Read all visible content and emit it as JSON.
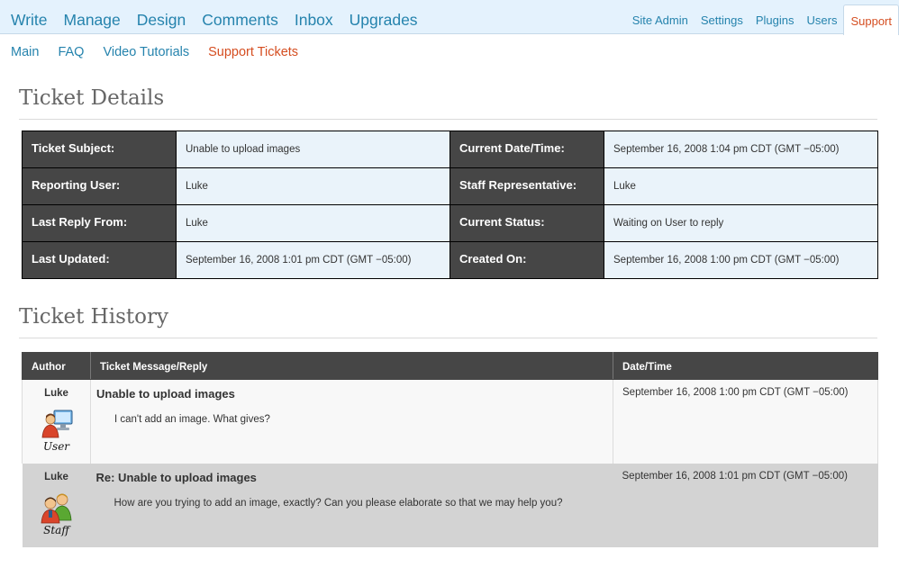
{
  "main_nav": [
    "Write",
    "Manage",
    "Design",
    "Comments",
    "Inbox",
    "Upgrades"
  ],
  "admin_nav": [
    "Site Admin",
    "Settings",
    "Plugins",
    "Users",
    "Support"
  ],
  "sub_nav": [
    "Main",
    "FAQ",
    "Video Tutorials",
    "Support Tickets"
  ],
  "details": {
    "title": "Ticket Details",
    "rows": [
      {
        "label1": "Ticket Subject:",
        "value1": "Unable to upload images",
        "label2": "Current Date/Time:",
        "value2": "September 16, 2008 1:04 pm CDT (GMT −05:00)"
      },
      {
        "label1": "Reporting User:",
        "value1": "Luke",
        "label2": "Staff Representative:",
        "value2": "Luke"
      },
      {
        "label1": "Last Reply From:",
        "value1": "Luke",
        "label2": "Current Status:",
        "value2": "Waiting on User to reply"
      },
      {
        "label1": "Last Updated:",
        "value1": "September 16, 2008 1:01 pm CDT (GMT −05:00)",
        "label2": "Created On:",
        "value2": "September 16, 2008 1:00 pm CDT (GMT −05:00)"
      }
    ]
  },
  "history": {
    "title": "Ticket History",
    "columns": [
      "Author",
      "Ticket Message/Reply",
      "Date/Time"
    ],
    "entries": [
      {
        "author": "Luke",
        "role_badge": "User",
        "avatar_icon": "user-computer-icon",
        "subject": "Unable to upload images",
        "message": "I can't add an image. What gives?",
        "date": "September 16, 2008 1:00 pm CDT (GMT −05:00)"
      },
      {
        "author": "Luke",
        "role_badge": "Staff",
        "avatar_icon": "staff-people-icon",
        "subject": "Re: Unable to upload images",
        "message": "How are you trying to add an image, exactly? Can you please elaborate so that we may help you?",
        "date": "September 16, 2008 1:01 pm CDT (GMT −05:00)"
      }
    ]
  },
  "colors": {
    "link": "#2583ad",
    "active": "#d54e21",
    "header_bg": "#e4f2fd",
    "label_bg": "#464646",
    "value_bg": "#eaf3fa",
    "staff_row_bg": "#d3d3d3"
  }
}
